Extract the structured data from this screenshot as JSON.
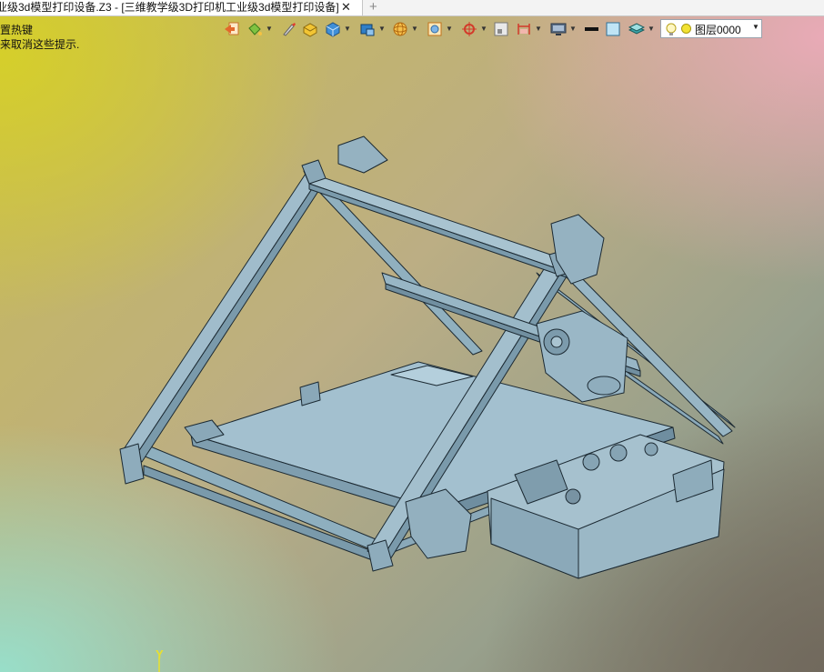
{
  "window": {
    "tab_title": "业级3d模型打印设备.Z3 - [三维教学级3D打印机工业级3d模型打印设备]",
    "close_glyph": "✕",
    "new_tab_glyph": "+"
  },
  "hints": {
    "line1": "置热键",
    "line2": "来取消这些提示."
  },
  "toolbar": {
    "icons": [
      "exit-icon",
      "paint-bucket-icon",
      "brush-icon",
      "box-render-icon",
      "cube-icon",
      "view-cube-icon",
      "wireframe-sphere-icon",
      "display-filter-icon",
      "target-icon",
      "frame-icon",
      "dimension-icon",
      "monitor-icon",
      "line-color-icon",
      "fill-color-icon",
      "layer-stack-icon"
    ],
    "layer_selector": {
      "value": "图层0000",
      "bulb": "lightbulb-icon",
      "color": "#f2e233"
    }
  },
  "viewport": {
    "axis_label": "Y",
    "model": "3D printer assembly"
  },
  "colors": {
    "model_fill": "#9bb8c7",
    "model_edge": "#1c2a33",
    "axis": "#e9e02d"
  }
}
